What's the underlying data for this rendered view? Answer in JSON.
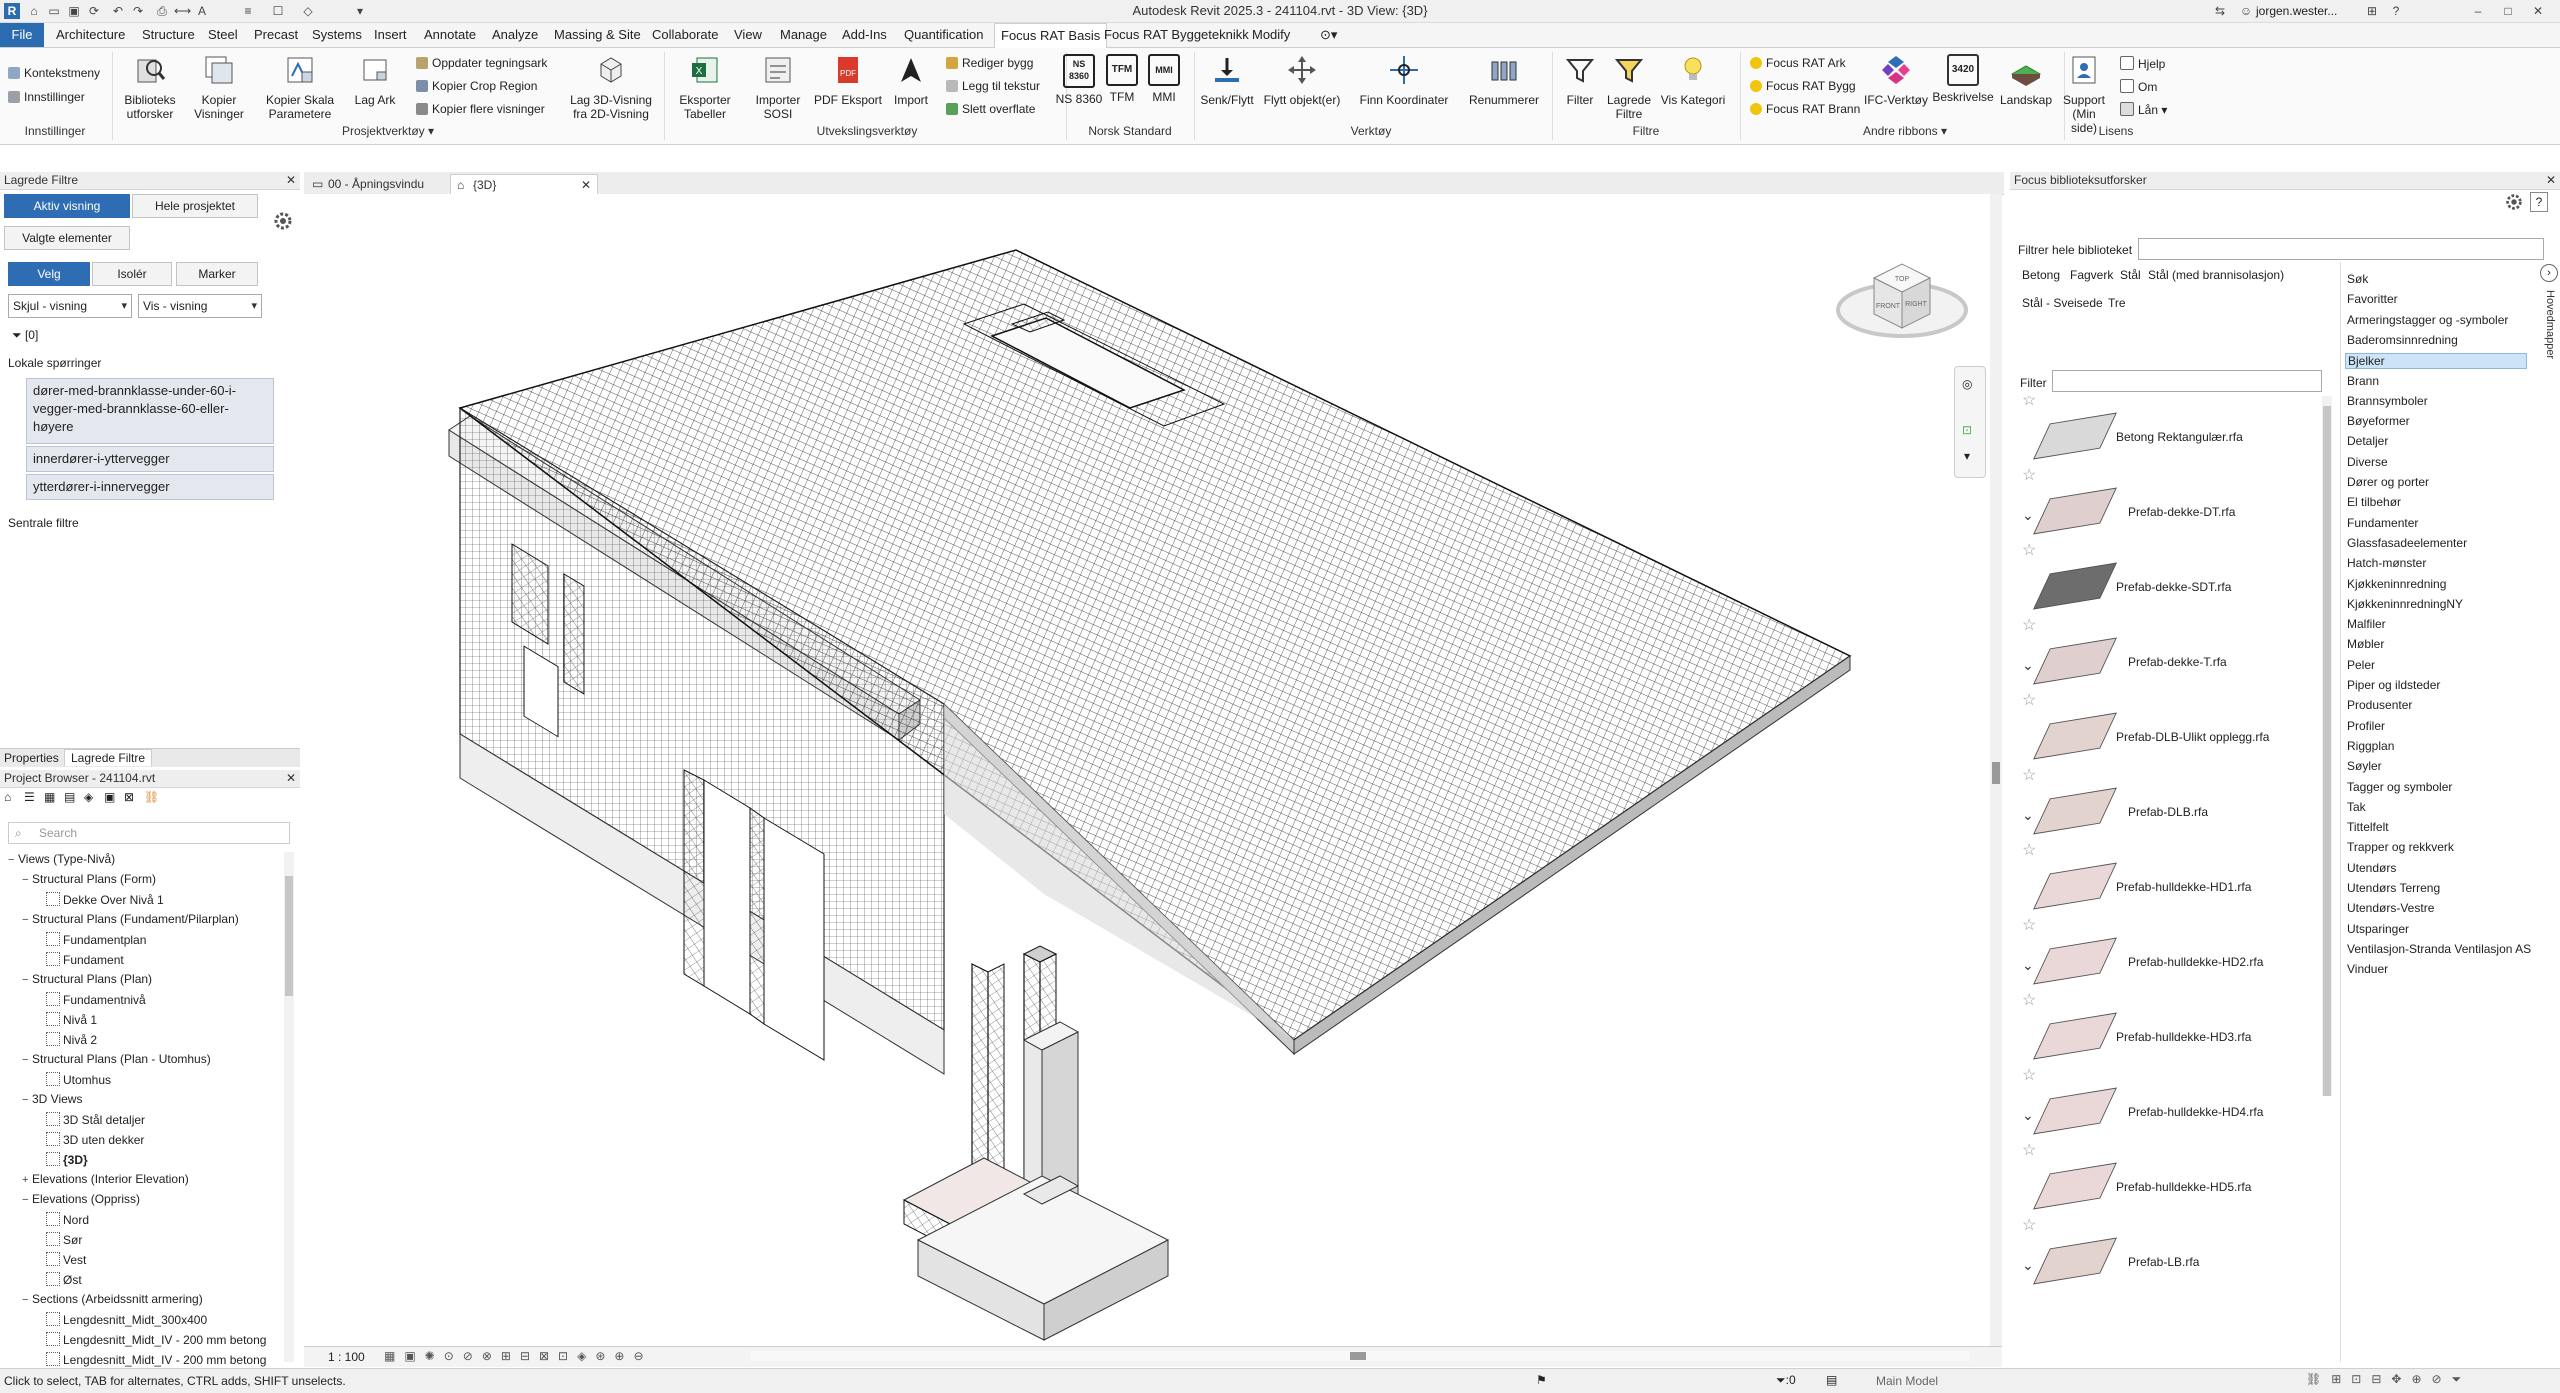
{
  "app": {
    "title": "Autodesk Revit 2025.3 - 241104.rvt - 3D View: {3D}",
    "user": "jorgen.wester..."
  },
  "tabs": [
    "File",
    "Architecture",
    "Structure",
    "Steel",
    "Precast",
    "Systems",
    "Insert",
    "Annotate",
    "Analyze",
    "Massing & Site",
    "Collaborate",
    "View",
    "Manage",
    "Add-Ins",
    "Quantification",
    "Focus RAT Basis",
    "Focus RAT Byggeteknikk",
    "Modify"
  ],
  "ribbon": {
    "innstillinger": {
      "kontekstmeny": "Kontekstmeny",
      "innstillinger": "Innstillinger",
      "group": "Innstillinger"
    },
    "big1": [
      {
        "label": "Biblioteks\nutforsker"
      },
      {
        "label": "Kopier\nVisninger"
      },
      {
        "label": "Kopier Skala\nParametere"
      },
      {
        "label": "Lag Ark"
      }
    ],
    "prosjekt_small": [
      "Oppdater tegningsark",
      "Kopier Crop Region",
      "Kopier flere visninger"
    ],
    "lag3d": "Lag 3D-Visning\nfra 2D-Visning",
    "prosjekt_group": "Prosjektverktøy",
    "utveksling": [
      {
        "label": "Eksporter\nTabeller"
      },
      {
        "label": "Importer\nSOSI"
      },
      {
        "label": "PDF Eksport"
      },
      {
        "label": "Import"
      }
    ],
    "utveksling_small": [
      "Rediger bygg",
      "Legg til tekstur",
      "Slett overflate"
    ],
    "utveksling_group": "Utvekslingsverktøy",
    "norsk": [
      {
        "label": "NS 8360"
      },
      {
        "label": "TFM"
      },
      {
        "label": "MMI"
      }
    ],
    "norsk_group": "Norsk Standard",
    "verktoy": [
      {
        "label": "Senk/Flytt"
      },
      {
        "label": "Flytt objekt(er)"
      },
      {
        "label": "Finn Koordinater"
      },
      {
        "label": "Renummerer"
      }
    ],
    "verktoy_group": "Verktøy",
    "filtre": [
      {
        "label": "Filter"
      },
      {
        "label": "Lagrede\nFiltre"
      },
      {
        "label": "Vis Kategori"
      }
    ],
    "filtre_group": "Filtre",
    "andre_small": [
      "Focus RAT Ark",
      "Focus RAT Bygg",
      "Focus RAT Brann"
    ],
    "andre": [
      {
        "label": "IFC-Verktøy"
      },
      {
        "label": "Beskrivelse"
      },
      {
        "label": "Landskap"
      }
    ],
    "andre_group": "Andre ribbons",
    "lisens": [
      {
        "label": "Support\n(Min side)"
      }
    ],
    "lisens_small": [
      "Hjelp",
      "Om",
      "Lån"
    ],
    "lisens_group": "Lisens",
    "icon_text": {
      "ns": "NS\n8360",
      "tfm": "TFM",
      "mmi": "MMI",
      "pdf": "PDF",
      "besk": "3420"
    }
  },
  "filters_panel": {
    "title": "Lagrede Filtre",
    "aktiv": "Aktiv visning",
    "hele": "Hele prosjektet",
    "valgte": "Valgte elementer",
    "velg": "Velg",
    "isoler": "Isolér",
    "marker": "Marker",
    "skjul": "Skjul - visning",
    "vis": "Vis - visning",
    "count": "[0]",
    "lokale": "Lokale spørringer",
    "queries": [
      "dører-med-brannklasse-under-60-i-vegger-med-brannklasse-60-eller-høyere",
      "innerdører-i-yttervegger",
      "ytterdører-i-innervegger"
    ],
    "sentrale": "Sentrale filtre",
    "tab_properties": "Properties",
    "tab_lagrede": "Lagrede Filtre"
  },
  "project_browser": {
    "title": "Project Browser - 241104.rvt",
    "search": "Search",
    "rows": [
      {
        "label": "Views (Type-Nivå)",
        "level": 0,
        "tog": "−"
      },
      {
        "label": "Structural Plans (Form)",
        "level": 1,
        "tog": "−"
      },
      {
        "label": "Dekke Over Nivå 1",
        "level": 2,
        "tog": ""
      },
      {
        "label": "Structural Plans (Fundament/Pilarplan)",
        "level": 1,
        "tog": "−"
      },
      {
        "label": "Fundamentplan",
        "level": 2,
        "tog": ""
      },
      {
        "label": "Fundament",
        "level": 2,
        "tog": ""
      },
      {
        "label": "Structural Plans (Plan)",
        "level": 1,
        "tog": "−"
      },
      {
        "label": "Fundamentnivå",
        "level": 2,
        "tog": ""
      },
      {
        "label": "Nivå 1",
        "level": 2,
        "tog": ""
      },
      {
        "label": "Nivå 2",
        "level": 2,
        "tog": ""
      },
      {
        "label": "Structural Plans (Plan - Utomhus)",
        "level": 1,
        "tog": "−"
      },
      {
        "label": "Utomhus",
        "level": 2,
        "tog": ""
      },
      {
        "label": "3D Views",
        "level": 1,
        "tog": "−"
      },
      {
        "label": "3D Stål detaljer",
        "level": 2,
        "tog": ""
      },
      {
        "label": "3D uten dekker",
        "level": 2,
        "tog": ""
      },
      {
        "label": "{3D}",
        "level": 2,
        "tog": "",
        "bold": true
      },
      {
        "label": "Elevations (Interior Elevation)",
        "level": 1,
        "tog": "+"
      },
      {
        "label": "Elevations (Oppriss)",
        "level": 1,
        "tog": "−"
      },
      {
        "label": "Nord",
        "level": 2,
        "tog": ""
      },
      {
        "label": "Sør",
        "level": 2,
        "tog": ""
      },
      {
        "label": "Vest",
        "level": 2,
        "tog": ""
      },
      {
        "label": "Øst",
        "level": 2,
        "tog": ""
      },
      {
        "label": "Sections (Arbeidssnitt armering)",
        "level": 1,
        "tog": "−"
      },
      {
        "label": "Lengdesnitt_Midt_300x400",
        "level": 2,
        "tog": ""
      },
      {
        "label": "Lengdesnitt_Midt_IV - 200 mm betong",
        "level": 2,
        "tog": ""
      },
      {
        "label": "Lengdesnitt_Midt_IV - 200 mm betong",
        "level": 2,
        "tog": ""
      }
    ]
  },
  "view_tabs": [
    {
      "label": "00 - Åpningsvindu"
    },
    {
      "label": "{3D}"
    }
  ],
  "viewcube": {
    "top": "TOP",
    "front": "FRONT",
    "right": "RIGHT"
  },
  "view_scale": "1 : 100",
  "library": {
    "title": "Focus biblioteksutforsker",
    "filter_all": "Filtrer hele biblioteket",
    "filter": "Filter",
    "subtabs": [
      "Betong",
      "Fagverk",
      "Stål",
      "Stål (med brannisolasjon)",
      "Stål - Sveisede",
      "Tre"
    ],
    "side_label": "Hovedmapper",
    "items": [
      "Betong Rektangulær.rfa",
      "Prefab-dekke-DT.rfa",
      "Prefab-dekke-SDT.rfa",
      "Prefab-dekke-T.rfa",
      "Prefab-DLB-Ulikt opplegg.rfa",
      "Prefab-DLB.rfa",
      "Prefab-hulldekke-HD1.rfa",
      "Prefab-hulldekke-HD2.rfa",
      "Prefab-hulldekke-HD3.rfa",
      "Prefab-hulldekke-HD4.rfa",
      "Prefab-hulldekke-HD5.rfa",
      "Prefab-LB.rfa"
    ],
    "categories": [
      "Søk",
      "Favoritter",
      "Armeringstagger og -symboler",
      "Baderomsinnredning",
      "Bjelker",
      "Brann",
      "Brannsymboler",
      "Bøyeformer",
      "Detaljer",
      "Diverse",
      "Dører og porter",
      "El tilbehør",
      "Fundamenter",
      "Glassfasadeelementer",
      "Hatch-mønster",
      "Kjøkkeninnredning",
      "KjøkkeninnredningNY",
      "Malfiler",
      "Møbler",
      "Peler",
      "Piper og ildsteder",
      "Produsenter",
      "Profiler",
      "Riggplan",
      "Søyler",
      "Tagger og symboler",
      "Tak",
      "Tittelfelt",
      "Trapper og rekkverk",
      "Utendørs",
      "Utendørs Terreng",
      "Utendørs-Vestre",
      "Utsparinger",
      "Ventilasjon-Stranda Ventilasjon AS",
      "Vinduer"
    ],
    "selected_category": "Bjelker"
  },
  "status": {
    "text": "Click to select, TAB for alternates, CTRL adds, SHIFT unselects.",
    "model": "Main Model",
    "sel": ":0"
  },
  "colors": {
    "accent": "#2e6db4",
    "filetab": "#2b6cb0",
    "selected": "#cce4f7"
  }
}
